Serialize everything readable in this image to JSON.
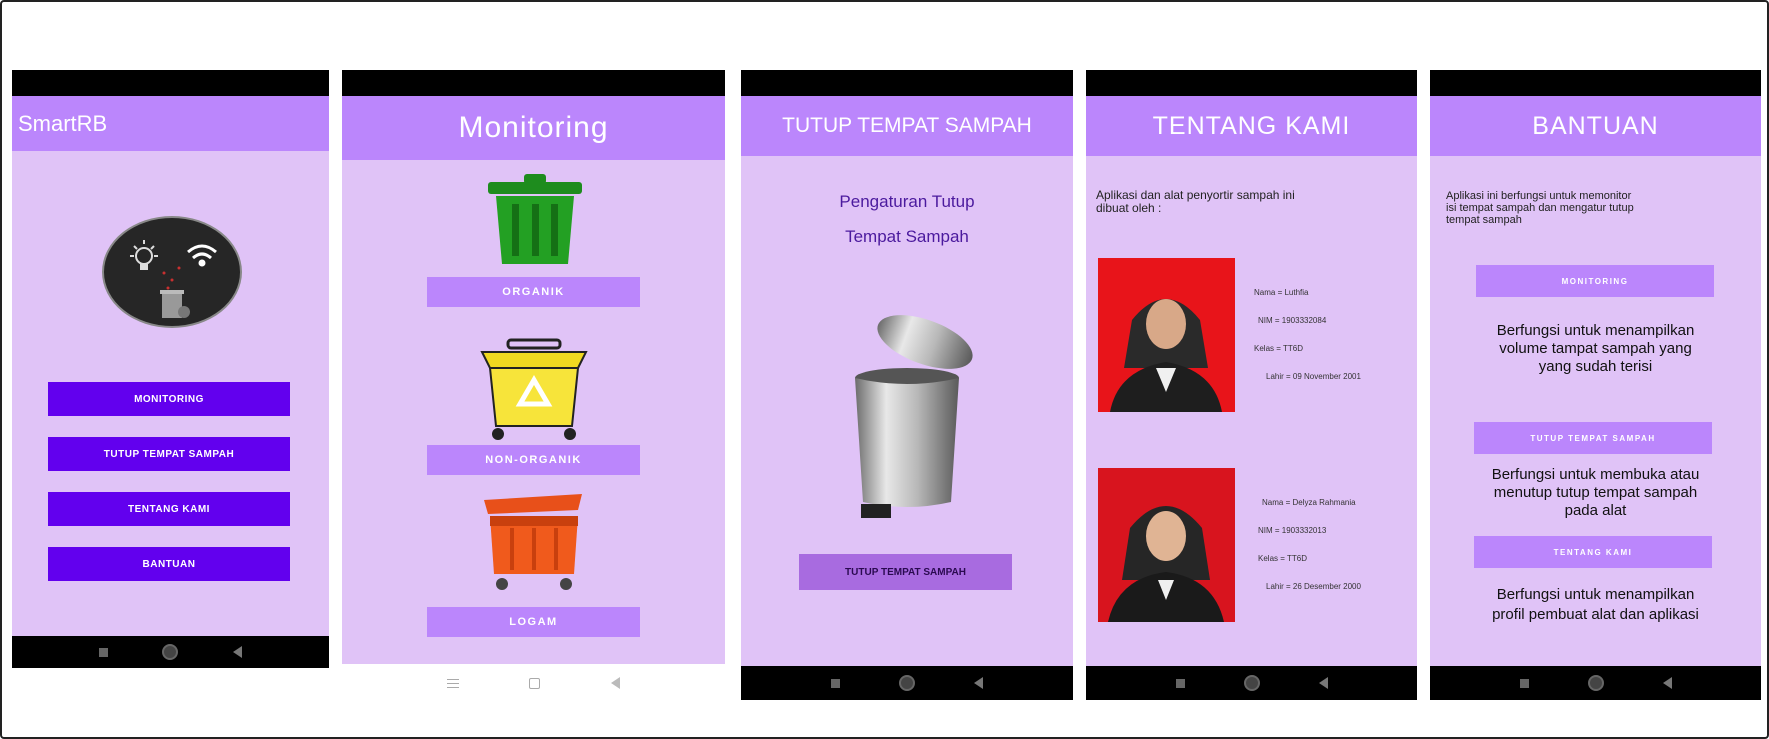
{
  "screen1": {
    "title": "SmartRB",
    "buttons": [
      "MONITORING",
      "TUTUP TEMPAT SAMPAH",
      "TENTANG KAMI",
      "BANTUAN"
    ]
  },
  "screen2": {
    "title": "Monitoring",
    "bins": [
      {
        "label": "ORGANIK",
        "color": "#1e8c1e"
      },
      {
        "label": "NON-ORGANIK",
        "color": "#f0d820"
      },
      {
        "label": "LOGAM",
        "color": "#e8501a"
      }
    ]
  },
  "screen3": {
    "title": "TUTUP TEMPAT SAMPAH",
    "heading_line1": "Pengaturan Tutup",
    "heading_line2": "Tempat Sampah",
    "button": "TUTUP TEMPAT SAMPAH"
  },
  "screen4": {
    "title": "TENTANG KAMI",
    "intro_line1": "Aplikasi dan alat penyortir sampah ini",
    "intro_line2": "dibuat oleh :",
    "persons": [
      {
        "nama": "Nama = Luthfia",
        "nim": "NIM = 1903332084",
        "kelas": "Kelas = TT6D",
        "lahir": "Lahir = 09 November 2001",
        "bg_color": "#e8141a"
      },
      {
        "nama": "Nama = Delyza Rahmania",
        "nim": "NIM = 1903332013",
        "kelas": "Kelas = TT6D",
        "lahir": "Lahir = 26 Desember 2000",
        "bg_color": "#d8141e"
      }
    ]
  },
  "screen5": {
    "title": "BANTUAN",
    "intro_line1": "Aplikasi ini berfungsi untuk memonitor",
    "intro_line2": "isi tempat sampah dan mengatur tutup",
    "intro_line3": "tempat sampah",
    "sections": [
      {
        "button": "MONITORING",
        "desc_line1": "Berfungsi untuk menampilkan",
        "desc_line2": "volume tampat sampah yang",
        "desc_line3": "yang sudah terisi"
      },
      {
        "button": "TUTUP TEMPAT SAMPAH",
        "desc_line1": "Berfungsi untuk membuka atau",
        "desc_line2": "menutup tutup tempat sampah",
        "desc_line3": "pada alat"
      },
      {
        "button": "TENTANG KAMI",
        "desc_line1": "Berfungsi untuk menampilkan",
        "desc_line2": "profil pembuat alat dan aplikasi",
        "desc_line3": ""
      }
    ]
  },
  "icons": [
    "bulb-icon",
    "wifi-icon",
    "trash-icon",
    "recycle-icon",
    "home-nav-icon",
    "back-nav-icon",
    "recent-nav-icon"
  ]
}
